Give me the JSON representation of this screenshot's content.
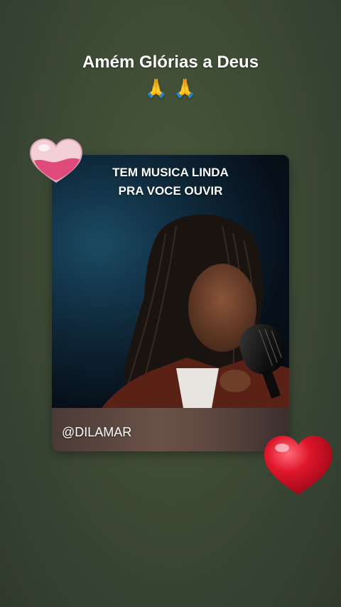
{
  "caption": {
    "text": "Amém Glórias a Deus",
    "emoji": "🙏 🙏"
  },
  "card": {
    "title_line1": "TEM MUSICA LINDA",
    "title_line2": "PRA VOCE OUVIR",
    "handle": "@DILAMAR",
    "photo_icon": "singer-with-microphone-photo"
  },
  "stickers": {
    "top": "glass-heart-sticker",
    "bottom": "red-heart-sticker"
  },
  "colors": {
    "background": "#3e4b35",
    "heart_red": "#e0162b",
    "heart_pink": "#e0507a"
  }
}
